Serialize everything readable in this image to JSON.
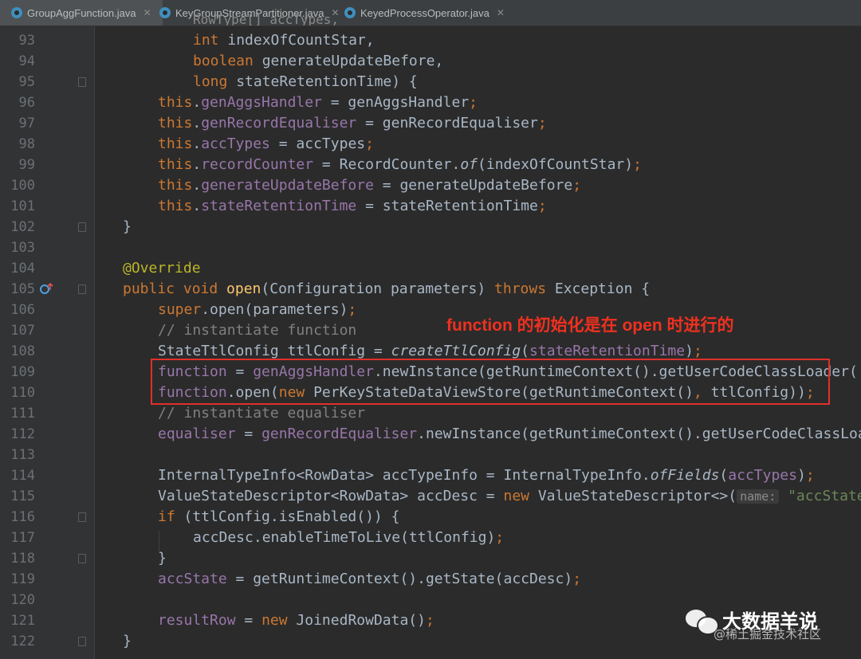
{
  "tabs": [
    {
      "label": "GroupAggFunction.java",
      "active": true
    },
    {
      "label": "KeyGroupStreamPartitioner.java",
      "active": false
    },
    {
      "label": "KeyedProcessOperator.java",
      "active": false
    }
  ],
  "tab_close_glyph": "✕",
  "line_numbers": [
    "93",
    "94",
    "95",
    "96",
    "97",
    "98",
    "99",
    "100",
    "101",
    "102",
    "103",
    "104",
    "105",
    "106",
    "107",
    "108",
    "109",
    "110",
    "111",
    "112",
    "113",
    "114",
    "115",
    "116",
    "117",
    "118",
    "119",
    "120",
    "121",
    "122"
  ],
  "code": {
    "l92_partial": "RowType[] accTypes,",
    "l93": "int indexOfCountStar,",
    "l94": "boolean generateUpdateBefore,",
    "l95": "long stateRetentionTime) {",
    "l96": "this.genAggsHandler = genAggsHandler;",
    "l97": "this.genRecordEqualiser = genRecordEqualiser;",
    "l98": "this.accTypes = accTypes;",
    "l99": "this.recordCounter = RecordCounter.of(indexOfCountStar);",
    "l100": "this.generateUpdateBefore = generateUpdateBefore;",
    "l101": "this.stateRetentionTime = stateRetentionTime;",
    "l102": "}",
    "l104": "@Override",
    "l105": "public void open(Configuration parameters) throws Exception {",
    "l106": "super.open(parameters);",
    "l107": "// instantiate function",
    "l108": "StateTtlConfig ttlConfig = createTtlConfig(stateRetentionTime);",
    "l109": "function = genAggsHandler.newInstance(getRuntimeContext().getUserCodeClassLoader(",
    "l110": "function.open(new PerKeyStateDataViewStore(getRuntimeContext(), ttlConfig));",
    "l111": "// instantiate equaliser",
    "l112": "equaliser = genRecordEqualiser.newInstance(getRuntimeContext().getUserCodeClassLoa",
    "l114": "InternalTypeInfo<RowData> accTypeInfo = InternalTypeInfo.ofFields(accTypes);",
    "l115_code": "ValueStateDescriptor<RowData> accDesc = new ValueStateDescriptor<>(",
    "l115_hint": "name:",
    "l115_str": "\"accState",
    "l116": "if (ttlConfig.isEnabled()) {",
    "l117": "accDesc.enableTimeToLive(ttlConfig);",
    "l118": "}",
    "l119": "accState = getRuntimeContext().getState(accDesc);",
    "l121": "resultRow = new JoinedRowData();",
    "l122": "}"
  },
  "annotation": "function 的初始化是在 open 时进行的",
  "watermark": {
    "name": "大数据羊说",
    "sub": "@稀土掘金技术社区"
  },
  "colors": {
    "accent_red": "#e0302a",
    "keyword": "#cc7832",
    "field": "#9876aa",
    "method": "#ffc66d"
  }
}
